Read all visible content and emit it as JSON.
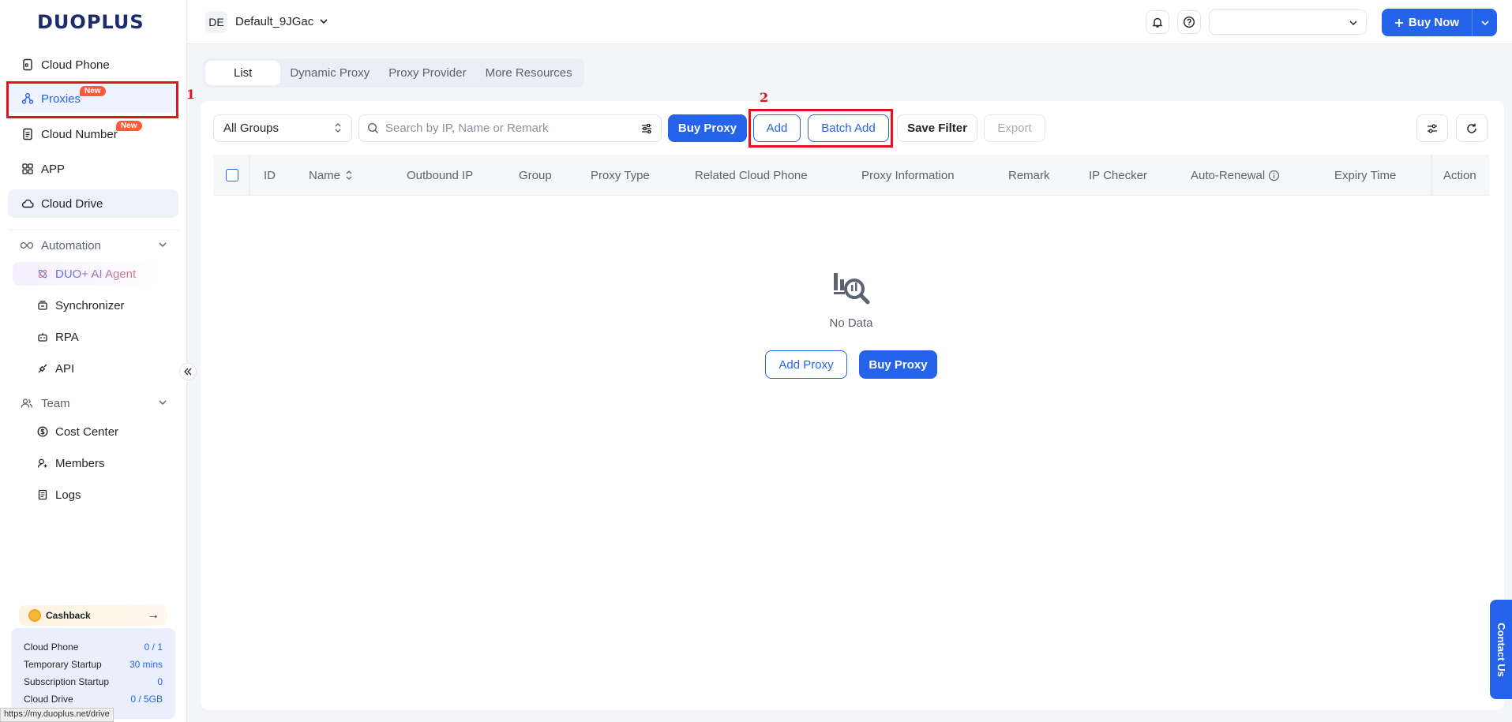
{
  "brand": {
    "logo": "DUOPLUS"
  },
  "sidebar": {
    "items": [
      {
        "label": "Cloud Phone"
      },
      {
        "label": "Proxies",
        "badge": "New"
      },
      {
        "label": "Cloud Number",
        "badge": "New"
      },
      {
        "label": "APP"
      },
      {
        "label": "Cloud Drive"
      }
    ],
    "automation": {
      "label": "Automation",
      "items": [
        {
          "label": "DUO+ AI Agent"
        },
        {
          "label": "Synchronizer"
        },
        {
          "label": "RPA"
        },
        {
          "label": "API"
        }
      ]
    },
    "team": {
      "label": "Team",
      "items": [
        {
          "label": "Cost Center"
        },
        {
          "label": "Members"
        },
        {
          "label": "Logs"
        }
      ]
    },
    "cashback": {
      "label": "Cashback",
      "arrow": "→"
    },
    "quota": [
      {
        "label": "Cloud Phone",
        "value": "0 / 1"
      },
      {
        "label": "Temporary Startup",
        "value": "30 mins"
      },
      {
        "label": "Subscription Startup",
        "value": "0"
      },
      {
        "label": "Cloud Drive",
        "value": "0 / 5GB"
      }
    ],
    "status_url": "https://my.duoplus.net/drive"
  },
  "annotations": {
    "one": "1",
    "two": "2"
  },
  "topbar": {
    "workspace_initials": "DE",
    "workspace_name": "Default_9JGac",
    "buy_now": "Buy Now"
  },
  "tabs": [
    "List",
    "Dynamic Proxy",
    "Proxy Provider",
    "More Resources"
  ],
  "toolbar": {
    "group_select": "All Groups",
    "search_placeholder": "Search by IP, Name or Remark",
    "buy_proxy": "Buy Proxy",
    "add": "Add",
    "batch_add": "Batch Add",
    "save_filter": "Save Filter",
    "export": "Export"
  },
  "table": {
    "columns": [
      "ID",
      "Name",
      "Outbound IP",
      "Group",
      "Proxy Type",
      "Related Cloud Phone",
      "Proxy Information",
      "Remark",
      "IP Checker",
      "Auto-Renewal",
      "Expiry Time",
      "Action"
    ]
  },
  "empty": {
    "text": "No Data",
    "add_proxy": "Add Proxy",
    "buy_proxy": "Buy Proxy"
  },
  "contact": "Contact Us"
}
